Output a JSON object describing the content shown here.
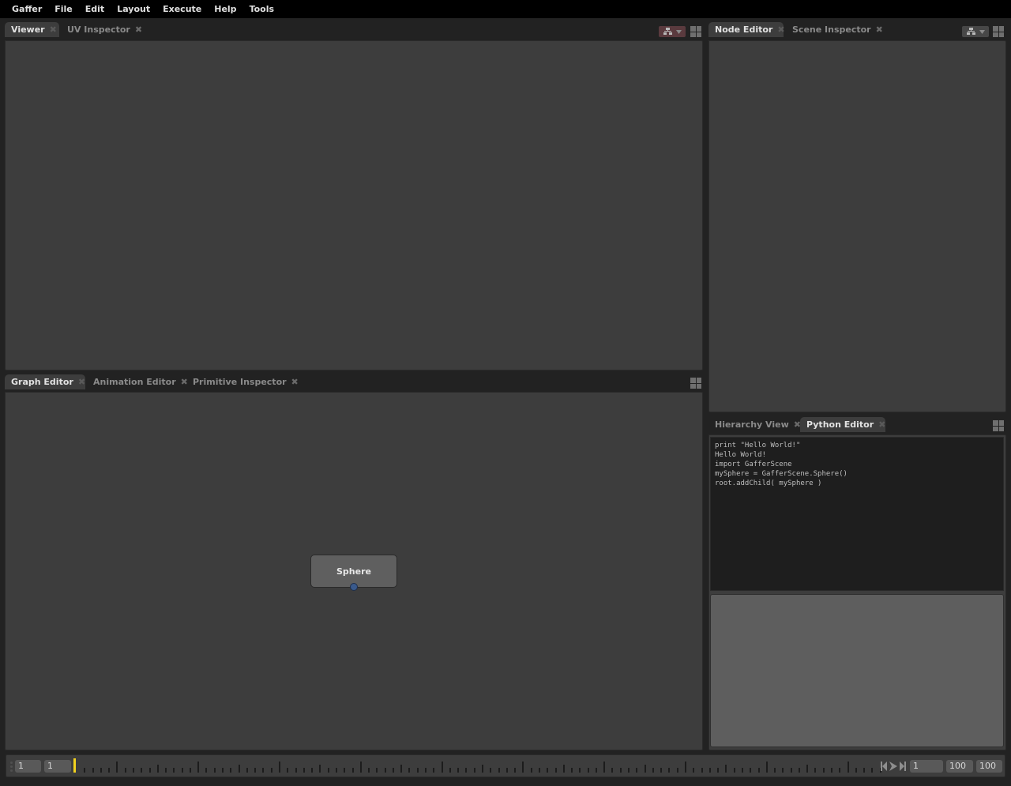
{
  "menubar": {
    "items": [
      "Gaffer",
      "File",
      "Edit",
      "Layout",
      "Execute",
      "Help",
      "Tools"
    ]
  },
  "viewer_panel": {
    "tabs": [
      {
        "label": "Viewer",
        "active": true
      },
      {
        "label": "UV Inspector",
        "active": false
      }
    ],
    "view_menu_color": "#5a3a3e"
  },
  "node_editor_panel": {
    "tabs": [
      {
        "label": "Node Editor",
        "active": true
      },
      {
        "label": "Scene Inspector",
        "active": false
      }
    ],
    "view_menu_color": "#474747"
  },
  "graph_editor_panel": {
    "tabs": [
      {
        "label": "Graph Editor",
        "active": true
      },
      {
        "label": "Animation Editor",
        "active": false
      },
      {
        "label": "Primitive Inspector",
        "active": false
      }
    ],
    "nodes": [
      {
        "label": "Sphere",
        "plug_color": "#3a5a8c"
      }
    ]
  },
  "python_panel": {
    "tabs": [
      {
        "label": "Hierarchy View",
        "active": false
      },
      {
        "label": "Python Editor",
        "active": true
      }
    ],
    "output_lines": [
      "print \"Hello World!\"",
      "Hello World!",
      "import GafferScene",
      "mySphere = GafferScene.Sphere()",
      "root.addChild( mySphere )"
    ],
    "input_value": ""
  },
  "timeline": {
    "start_frame": "1",
    "playback_start": "1",
    "current_frame": "1",
    "playback_end": "100",
    "end_frame": "100",
    "playhead_color": "#f2d21e",
    "close_glyph": "✖"
  }
}
